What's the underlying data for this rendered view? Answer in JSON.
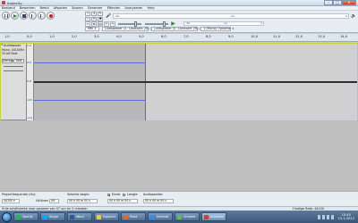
{
  "window": {
    "title": "Audacity",
    "minimize": "–",
    "maximize": "□",
    "close": "✕"
  },
  "menu": [
    "Bestand",
    "Bewerken",
    "Beeld",
    "Afspelen",
    "Sporen",
    "Genereer",
    "Effecten",
    "Analyseren",
    "Help"
  ],
  "meter": {
    "scale": [
      "-48",
      "-24",
      "0"
    ]
  },
  "playmeter": {
    "scale": [
      "-48",
      "-24",
      "0"
    ]
  },
  "devices": {
    "host": "MM",
    "input": "Luidspreker (2- Conexant 20) (m)",
    "output": "Luidspreker (2- Conexant 20) (m)",
    "channels": "1 (Mono) Opname"
  },
  "ruler": [
    "1,0",
    "0,0",
    "1,0",
    "2,0",
    "3,0",
    "4,0",
    "5,0",
    "6,0",
    "7,0",
    "8,0",
    "9,0",
    "10,0",
    "11,0",
    "12,0",
    "13,0",
    "14,0"
  ],
  "track": {
    "name": "Audiospoor",
    "info": [
      "Mono, 44100Hz",
      "32-bit float"
    ],
    "mute": "Dempen",
    "solo": "Solo",
    "vscale": [
      "1,0",
      "0,5",
      "0,0",
      "-0,5",
      "-1,0"
    ]
  },
  "selection": {
    "rate_label": "Projectfrequentie (Hz):",
    "rate_value": "44100",
    "snap_label": "Uitlijnen",
    "snap_value": "Uit",
    "start_label": "Selectie begin:",
    "end_label": "Einde",
    "length_label": "Lengte",
    "end_value": "00 h 00 m 00 s",
    "pos_label": "Audiopositie:",
    "pos_value": "00 h 00 m 00 s",
    "start_value": "00 h 00 m 00 s"
  },
  "status": {
    "text": "Vrije schijfruimte voor opname van 57 uur en 2 minuten",
    "rate": "Huidige Rate: 44100"
  },
  "taskbar": {
    "tasks": [
      {
        "label": "Spotify",
        "color": "#1db954"
      },
      {
        "label": "Skype",
        "color": "#00aff0"
      },
      {
        "label": "Word",
        "color": "#2b5797"
      },
      {
        "label": "Explorer",
        "color": "#f3c93f"
      },
      {
        "label": "Paint",
        "color": "#e06a2a"
      },
      {
        "label": "Internet",
        "color": "#3c8be0"
      },
      {
        "label": "Chrome",
        "color": "#5db858"
      },
      {
        "label": "Audacity",
        "color": "#d23f2a"
      }
    ],
    "time": "10:45",
    "date": "23-1-2012"
  }
}
